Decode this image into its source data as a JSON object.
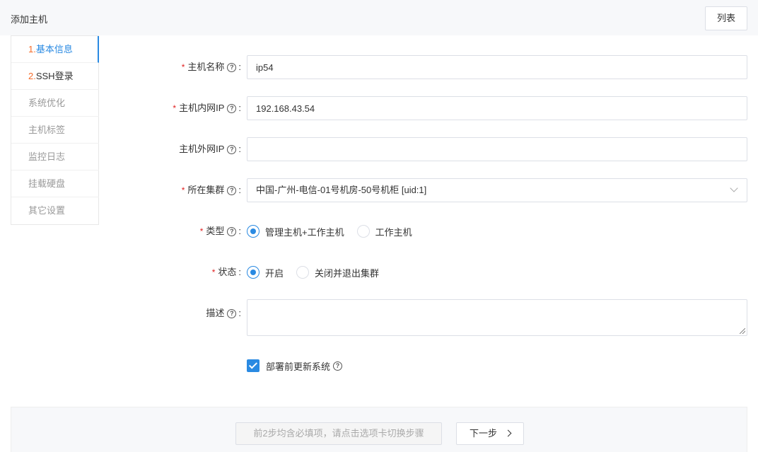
{
  "header": {
    "title": "添加主机",
    "list_button": "列表"
  },
  "steps": [
    {
      "num": "1.",
      "label": "基本信息",
      "state": "active"
    },
    {
      "num": "2.",
      "label": "SSH登录",
      "state": "required"
    },
    {
      "num": "",
      "label": "系统优化",
      "state": "normal"
    },
    {
      "num": "",
      "label": "主机标签",
      "state": "normal"
    },
    {
      "num": "",
      "label": "监控日志",
      "state": "normal"
    },
    {
      "num": "",
      "label": "挂载硬盘",
      "state": "normal"
    },
    {
      "num": "",
      "label": "其它设置",
      "state": "normal"
    }
  ],
  "form": {
    "host_name": {
      "label": "主机名称",
      "required": true,
      "value": "ip54"
    },
    "internal_ip": {
      "label": "主机内网IP",
      "required": true,
      "value": "192.168.43.54"
    },
    "external_ip": {
      "label": "主机外网IP",
      "required": false,
      "value": ""
    },
    "cluster": {
      "label": "所在集群",
      "required": true,
      "value": "中国-广州-电信-01号机房-50号机柜 [uid:1]"
    },
    "type": {
      "label": "类型",
      "required": true,
      "options": [
        "管理主机+工作主机",
        "工作主机"
      ],
      "selected": "管理主机+工作主机"
    },
    "status": {
      "label": "状态",
      "required": true,
      "options": [
        "开启",
        "关闭并退出集群"
      ],
      "selected": "开启"
    },
    "description": {
      "label": "描述",
      "value": ""
    },
    "update_system": {
      "label": "部署前更新系统",
      "checked": true
    }
  },
  "footer": {
    "hint": "前2步均含必填项，请点击选项卡切换步骤",
    "next_button": "下一步"
  },
  "colors": {
    "accent": "#2a8ae2",
    "required": "#e02020",
    "step_number": "#f56c2a"
  }
}
